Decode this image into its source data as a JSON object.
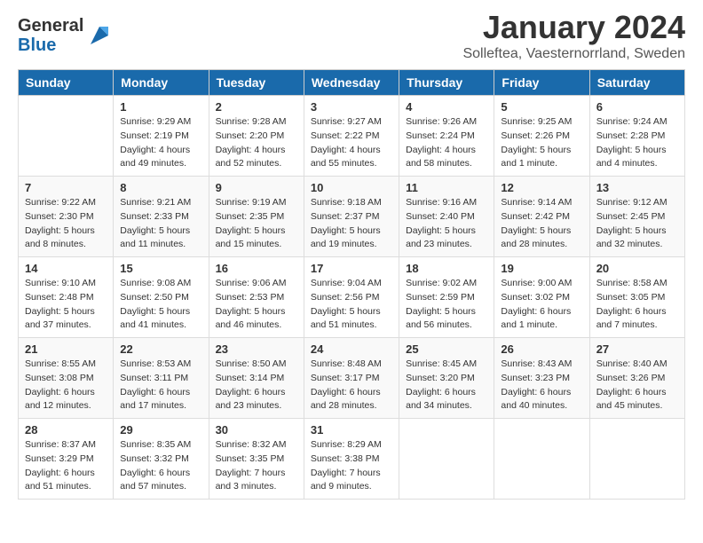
{
  "logo": {
    "general": "General",
    "blue": "Blue"
  },
  "title": "January 2024",
  "subtitle": "Solleftea, Vaesternorrland, Sweden",
  "days_of_week": [
    "Sunday",
    "Monday",
    "Tuesday",
    "Wednesday",
    "Thursday",
    "Friday",
    "Saturday"
  ],
  "weeks": [
    [
      {
        "day": "",
        "sunrise": "",
        "sunset": "",
        "daylight": ""
      },
      {
        "day": "1",
        "sunrise": "Sunrise: 9:29 AM",
        "sunset": "Sunset: 2:19 PM",
        "daylight": "Daylight: 4 hours and 49 minutes."
      },
      {
        "day": "2",
        "sunrise": "Sunrise: 9:28 AM",
        "sunset": "Sunset: 2:20 PM",
        "daylight": "Daylight: 4 hours and 52 minutes."
      },
      {
        "day": "3",
        "sunrise": "Sunrise: 9:27 AM",
        "sunset": "Sunset: 2:22 PM",
        "daylight": "Daylight: 4 hours and 55 minutes."
      },
      {
        "day": "4",
        "sunrise": "Sunrise: 9:26 AM",
        "sunset": "Sunset: 2:24 PM",
        "daylight": "Daylight: 4 hours and 58 minutes."
      },
      {
        "day": "5",
        "sunrise": "Sunrise: 9:25 AM",
        "sunset": "Sunset: 2:26 PM",
        "daylight": "Daylight: 5 hours and 1 minute."
      },
      {
        "day": "6",
        "sunrise": "Sunrise: 9:24 AM",
        "sunset": "Sunset: 2:28 PM",
        "daylight": "Daylight: 5 hours and 4 minutes."
      }
    ],
    [
      {
        "day": "7",
        "sunrise": "Sunrise: 9:22 AM",
        "sunset": "Sunset: 2:30 PM",
        "daylight": "Daylight: 5 hours and 8 minutes."
      },
      {
        "day": "8",
        "sunrise": "Sunrise: 9:21 AM",
        "sunset": "Sunset: 2:33 PM",
        "daylight": "Daylight: 5 hours and 11 minutes."
      },
      {
        "day": "9",
        "sunrise": "Sunrise: 9:19 AM",
        "sunset": "Sunset: 2:35 PM",
        "daylight": "Daylight: 5 hours and 15 minutes."
      },
      {
        "day": "10",
        "sunrise": "Sunrise: 9:18 AM",
        "sunset": "Sunset: 2:37 PM",
        "daylight": "Daylight: 5 hours and 19 minutes."
      },
      {
        "day": "11",
        "sunrise": "Sunrise: 9:16 AM",
        "sunset": "Sunset: 2:40 PM",
        "daylight": "Daylight: 5 hours and 23 minutes."
      },
      {
        "day": "12",
        "sunrise": "Sunrise: 9:14 AM",
        "sunset": "Sunset: 2:42 PM",
        "daylight": "Daylight: 5 hours and 28 minutes."
      },
      {
        "day": "13",
        "sunrise": "Sunrise: 9:12 AM",
        "sunset": "Sunset: 2:45 PM",
        "daylight": "Daylight: 5 hours and 32 minutes."
      }
    ],
    [
      {
        "day": "14",
        "sunrise": "Sunrise: 9:10 AM",
        "sunset": "Sunset: 2:48 PM",
        "daylight": "Daylight: 5 hours and 37 minutes."
      },
      {
        "day": "15",
        "sunrise": "Sunrise: 9:08 AM",
        "sunset": "Sunset: 2:50 PM",
        "daylight": "Daylight: 5 hours and 41 minutes."
      },
      {
        "day": "16",
        "sunrise": "Sunrise: 9:06 AM",
        "sunset": "Sunset: 2:53 PM",
        "daylight": "Daylight: 5 hours and 46 minutes."
      },
      {
        "day": "17",
        "sunrise": "Sunrise: 9:04 AM",
        "sunset": "Sunset: 2:56 PM",
        "daylight": "Daylight: 5 hours and 51 minutes."
      },
      {
        "day": "18",
        "sunrise": "Sunrise: 9:02 AM",
        "sunset": "Sunset: 2:59 PM",
        "daylight": "Daylight: 5 hours and 56 minutes."
      },
      {
        "day": "19",
        "sunrise": "Sunrise: 9:00 AM",
        "sunset": "Sunset: 3:02 PM",
        "daylight": "Daylight: 6 hours and 1 minute."
      },
      {
        "day": "20",
        "sunrise": "Sunrise: 8:58 AM",
        "sunset": "Sunset: 3:05 PM",
        "daylight": "Daylight: 6 hours and 7 minutes."
      }
    ],
    [
      {
        "day": "21",
        "sunrise": "Sunrise: 8:55 AM",
        "sunset": "Sunset: 3:08 PM",
        "daylight": "Daylight: 6 hours and 12 minutes."
      },
      {
        "day": "22",
        "sunrise": "Sunrise: 8:53 AM",
        "sunset": "Sunset: 3:11 PM",
        "daylight": "Daylight: 6 hours and 17 minutes."
      },
      {
        "day": "23",
        "sunrise": "Sunrise: 8:50 AM",
        "sunset": "Sunset: 3:14 PM",
        "daylight": "Daylight: 6 hours and 23 minutes."
      },
      {
        "day": "24",
        "sunrise": "Sunrise: 8:48 AM",
        "sunset": "Sunset: 3:17 PM",
        "daylight": "Daylight: 6 hours and 28 minutes."
      },
      {
        "day": "25",
        "sunrise": "Sunrise: 8:45 AM",
        "sunset": "Sunset: 3:20 PM",
        "daylight": "Daylight: 6 hours and 34 minutes."
      },
      {
        "day": "26",
        "sunrise": "Sunrise: 8:43 AM",
        "sunset": "Sunset: 3:23 PM",
        "daylight": "Daylight: 6 hours and 40 minutes."
      },
      {
        "day": "27",
        "sunrise": "Sunrise: 8:40 AM",
        "sunset": "Sunset: 3:26 PM",
        "daylight": "Daylight: 6 hours and 45 minutes."
      }
    ],
    [
      {
        "day": "28",
        "sunrise": "Sunrise: 8:37 AM",
        "sunset": "Sunset: 3:29 PM",
        "daylight": "Daylight: 6 hours and 51 minutes."
      },
      {
        "day": "29",
        "sunrise": "Sunrise: 8:35 AM",
        "sunset": "Sunset: 3:32 PM",
        "daylight": "Daylight: 6 hours and 57 minutes."
      },
      {
        "day": "30",
        "sunrise": "Sunrise: 8:32 AM",
        "sunset": "Sunset: 3:35 PM",
        "daylight": "Daylight: 7 hours and 3 minutes."
      },
      {
        "day": "31",
        "sunrise": "Sunrise: 8:29 AM",
        "sunset": "Sunset: 3:38 PM",
        "daylight": "Daylight: 7 hours and 9 minutes."
      },
      {
        "day": "",
        "sunrise": "",
        "sunset": "",
        "daylight": ""
      },
      {
        "day": "",
        "sunrise": "",
        "sunset": "",
        "daylight": ""
      },
      {
        "day": "",
        "sunrise": "",
        "sunset": "",
        "daylight": ""
      }
    ]
  ]
}
